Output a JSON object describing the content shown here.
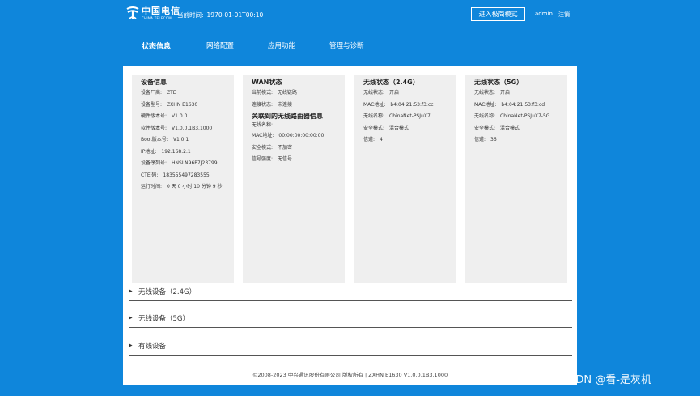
{
  "header": {
    "logo_cn": "中国电信",
    "logo_en": "CHINA TELECOM",
    "current_time_label": "当前时间:",
    "current_time_value": "1970-01-01T00:10",
    "simple_mode_label": "进入极简模式",
    "user": "admin",
    "logout": "注销"
  },
  "nav": {
    "items": [
      {
        "label": "状态信息"
      },
      {
        "label": "网络配置"
      },
      {
        "label": "应用功能"
      },
      {
        "label": "管理与诊断"
      }
    ]
  },
  "cards": {
    "device": {
      "title": "设备信息",
      "rows": [
        {
          "k": "设备厂商:",
          "v": "ZTE"
        },
        {
          "k": "设备型号:",
          "v": "ZXHN E1630"
        },
        {
          "k": "硬件版本号:",
          "v": "V1.0.0"
        },
        {
          "k": "软件版本号:",
          "v": "V1.0.0.1B3.1000"
        },
        {
          "k": "Boot版本号:",
          "v": "V1.0.1"
        },
        {
          "k": "IP地址:",
          "v": "192.168.2.1"
        },
        {
          "k": "设备序列号:",
          "v": "HNSLN96P7J23799"
        },
        {
          "k": "CTEI码:",
          "v": "183555497283555"
        },
        {
          "k": "运行时间:",
          "v": "0 天 0 小时 10 分钟 9 秒"
        }
      ]
    },
    "wan": {
      "title": "WAN状态",
      "rows": [
        {
          "k": "当前模式:",
          "v": "无线链路"
        },
        {
          "k": "连接状态:",
          "v": "未连接"
        }
      ],
      "sub_title": "关联到的无线路由器信息",
      "sub_rows": [
        {
          "k": "无线名称:",
          "v": ""
        },
        {
          "k": "MAC地址:",
          "v": "00:00:00:00:00:00"
        },
        {
          "k": "安全模式:",
          "v": "不加密"
        },
        {
          "k": "信号强度:",
          "v": "无信号"
        }
      ]
    },
    "wifi24": {
      "title": "无线状态（2.4G）",
      "rows": [
        {
          "k": "无线状态:",
          "v": "开启"
        },
        {
          "k": "MAC地址:",
          "v": "b4:04:21:53:f3:cc"
        },
        {
          "k": "无线名称:",
          "v": "ChinaNet-PSJuX7"
        },
        {
          "k": "安全模式:",
          "v": "混合模式"
        },
        {
          "k": "信道:",
          "v": "4"
        }
      ]
    },
    "wifi5": {
      "title": "无线状态（5G）",
      "rows": [
        {
          "k": "无线状态:",
          "v": "开启"
        },
        {
          "k": "MAC地址:",
          "v": "b4:04:21:53:f3:cd"
        },
        {
          "k": "无线名称:",
          "v": "ChinaNet-PSJuX7-5G"
        },
        {
          "k": "安全模式:",
          "v": "混合模式"
        },
        {
          "k": "信道:",
          "v": "36"
        }
      ]
    }
  },
  "sections": [
    {
      "label": "无线设备（2.4G）"
    },
    {
      "label": "无线设备（5G）"
    },
    {
      "label": "有线设备"
    }
  ],
  "footer": "©2008-2023 中兴通讯股份有限公司 版权所有  |  ZXHN E1630 V1.0.0.1B3.1000",
  "watermark": "CSDN @看-是灰机",
  "colors": {
    "background": "#0f86db",
    "panel": "#ffffff",
    "card": "#efefef"
  },
  "icons": {
    "logo": "china-telecom-logo",
    "expand": "triangle-right-icon"
  }
}
